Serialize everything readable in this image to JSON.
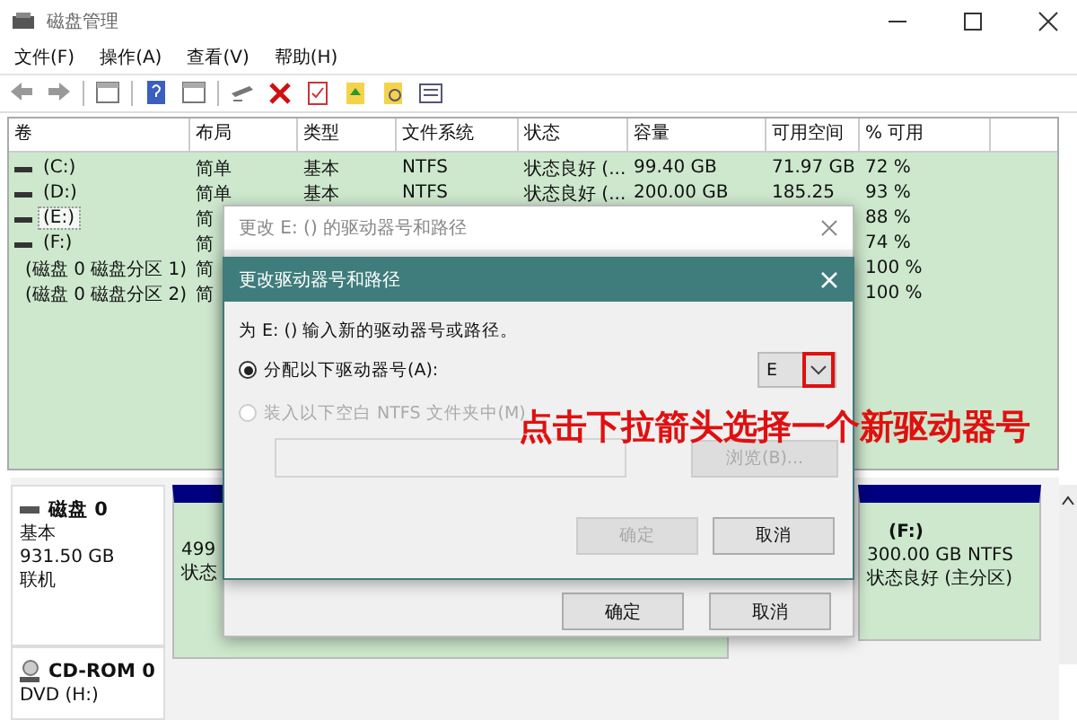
{
  "window": {
    "title": "磁盘管理"
  },
  "menu": [
    "文件(F)",
    "操作(A)",
    "查看(V)",
    "帮助(H)"
  ],
  "volumes": {
    "columns": [
      "卷",
      "布局",
      "类型",
      "文件系统",
      "状态",
      "容量",
      "可用空间",
      "% 可用"
    ],
    "rows": [
      {
        "volume": "(C:)",
        "layout": "简单",
        "type": "基本",
        "file_system": "NTFS",
        "status": "状态良好 (...",
        "capacity": "99.40 GB",
        "free_space": "71.97 GB",
        "percent_free": "72 %",
        "selected": false
      },
      {
        "volume": "(D:)",
        "layout": "简单",
        "type": "基本",
        "file_system": "NTFS",
        "status": "状态良好 (...",
        "capacity": "200.00 GB",
        "free_space": "185.25",
        "percent_free": "93 %",
        "selected": false
      },
      {
        "volume": "(E:)",
        "layout": "简",
        "percent_free": "88 %",
        "selected": true
      },
      {
        "volume": "(F:)",
        "layout": "简",
        "percent_free": "74 %",
        "selected": false
      },
      {
        "volume": "(磁盘 0 磁盘分区 1)",
        "layout": "简",
        "percent_free": "100 %",
        "selected": false
      },
      {
        "volume": "(磁盘 0 磁盘分区 2)",
        "layout": "简",
        "percent_free": "100 %",
        "selected": false
      }
    ]
  },
  "disks": [
    {
      "kind": "disk",
      "name": "磁盘 0",
      "lines": [
        "基本",
        "931.50 GB",
        "联机"
      ],
      "partitions": [
        {
          "lines": [
            "499",
            "状态"
          ]
        },
        {
          "title": "(F:)",
          "lines": [
            "300.00 GB NTFS",
            "状态良好 (主分区)"
          ]
        }
      ]
    },
    {
      "kind": "cdrom",
      "name": "CD-ROM 0",
      "lines": [
        "DVD (H:)"
      ]
    }
  ],
  "back_dialog": {
    "title": "更改 E: () 的驱动器号和路径",
    "buttons": [
      {
        "label": "确定",
        "disabled": false
      },
      {
        "label": "取消",
        "disabled": false
      }
    ]
  },
  "dialog": {
    "title": "更改驱动器号和路径",
    "prompt": "为 E: () 输入新的驱动器号或路径。",
    "options": [
      {
        "label": "分配以下驱动器号(A):",
        "selected": true,
        "disabled": false
      },
      {
        "label": "装入以下空白 NTFS 文件夹中(M)",
        "selected": false,
        "disabled": true
      }
    ],
    "drive_letter": "E",
    "browse": {
      "label": "浏览(B)...",
      "disabled": true
    },
    "buttons": [
      {
        "label": "确定",
        "disabled": true
      },
      {
        "label": "取消",
        "disabled": false
      }
    ]
  },
  "annotation": "点击下拉箭头选择一个新驱动器号"
}
